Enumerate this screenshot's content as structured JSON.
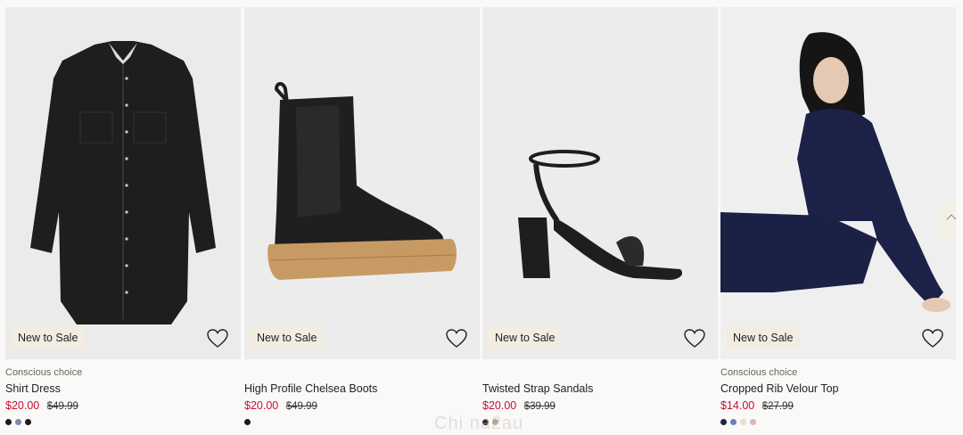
{
  "products": [
    {
      "badge": "New to Sale",
      "conscious": "Conscious choice",
      "title": "Shirt Dress",
      "sale_price": "$20.00",
      "original_price": "$49.99",
      "swatches": [
        "#1c1c1c",
        "#7c8aa6",
        "#1c1c1c"
      ],
      "image": "black denim shirt dress"
    },
    {
      "badge": "New to Sale",
      "conscious": "",
      "title": "High Profile Chelsea Boots",
      "sale_price": "$20.00",
      "original_price": "$49.99",
      "swatches": [
        "#1c1c1c"
      ],
      "image": "black chelsea boot with tan platform sole"
    },
    {
      "badge": "New to Sale",
      "conscious": "",
      "title": "Twisted Strap Sandals",
      "sale_price": "$20.00",
      "original_price": "$39.99",
      "swatches": [
        "#1c1c1c",
        "#b8a48a"
      ],
      "image": "black block heel sandal"
    },
    {
      "badge": "New to Sale",
      "conscious": "Conscious choice",
      "title": "Cropped Rib Velour Top",
      "sale_price": "$14.00",
      "original_price": "$27.99",
      "swatches": [
        "#1f2340",
        "#6c80c0",
        "#eadfc8",
        "#d9b8b0"
      ],
      "image": "model in navy velour set"
    }
  ],
  "watermark": "Chi na2au",
  "icons": {
    "wishlist": "heart-icon",
    "next": "chevron-up-icon"
  }
}
